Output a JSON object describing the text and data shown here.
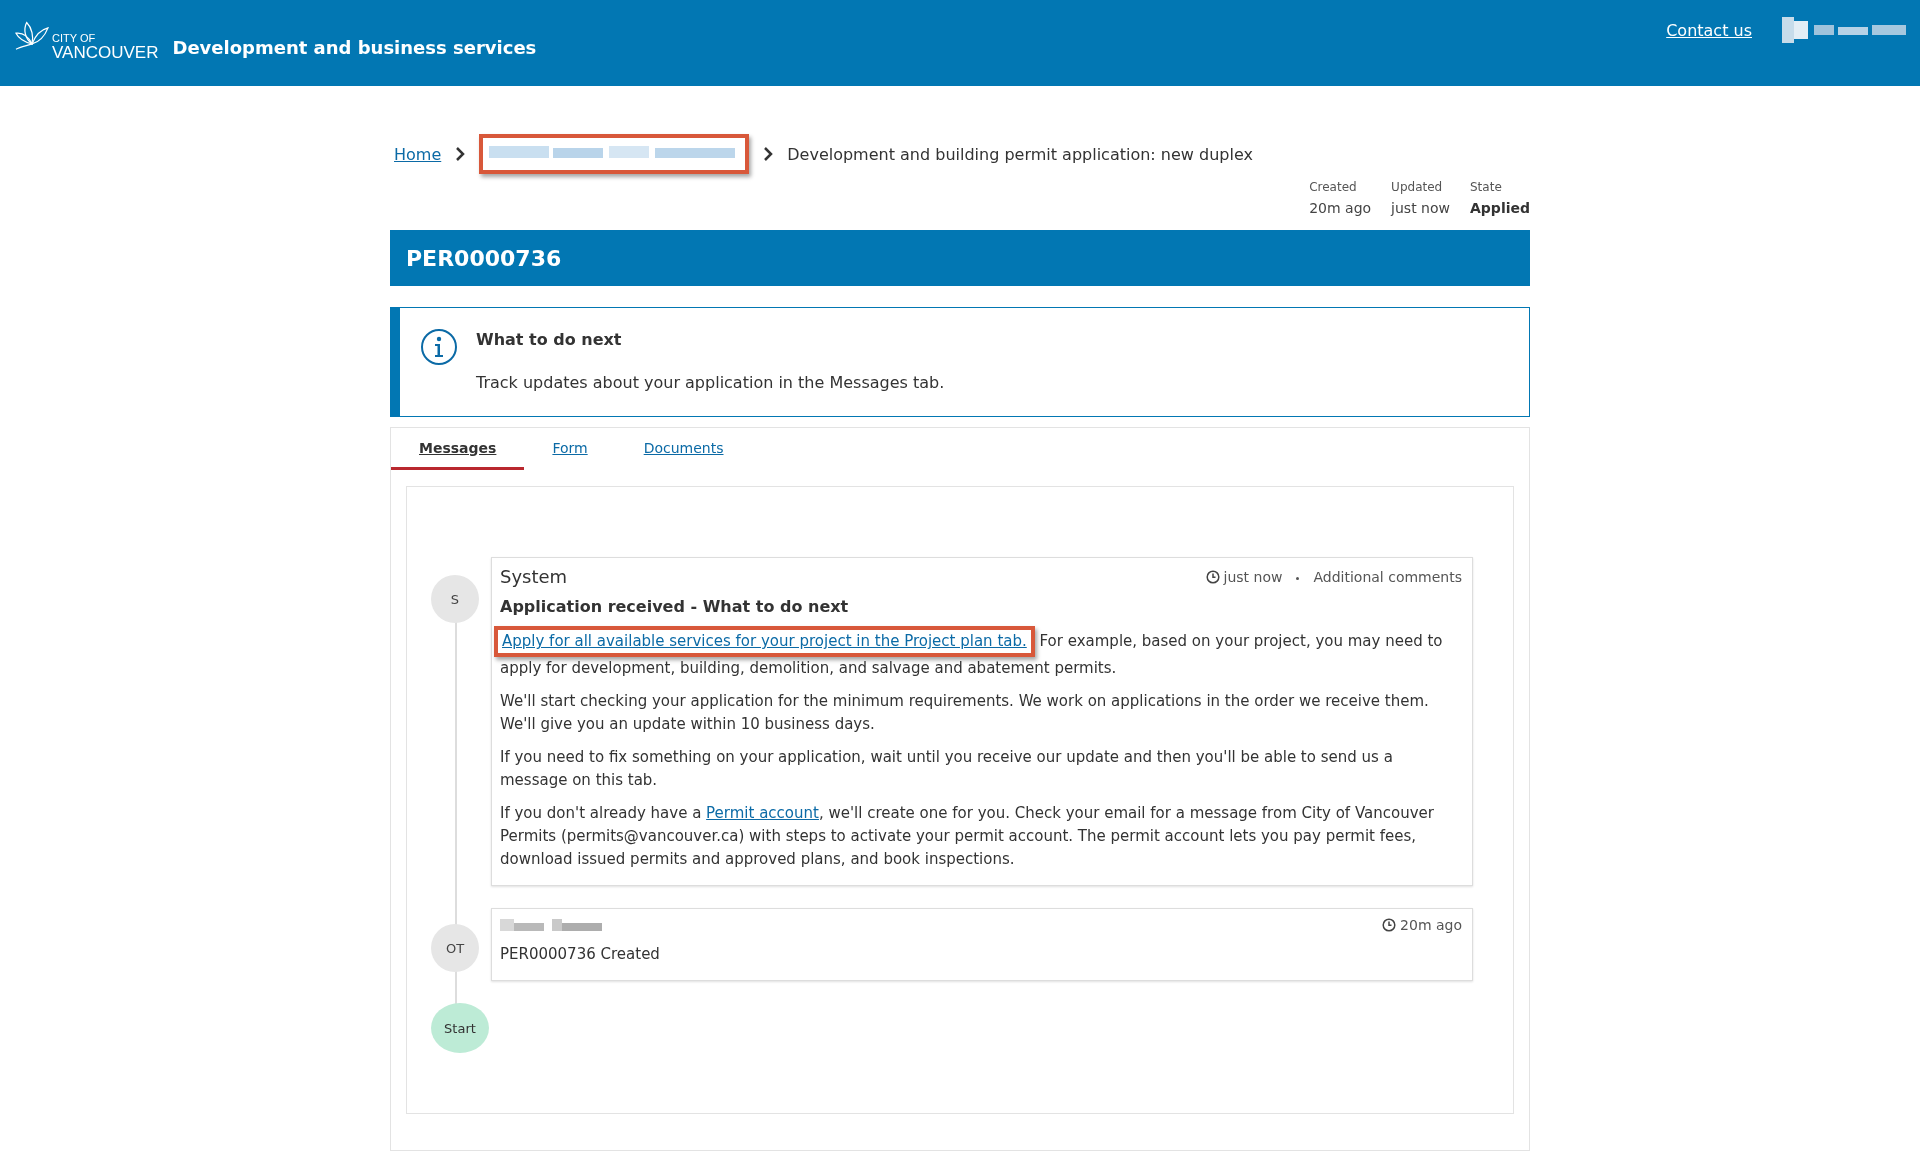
{
  "header": {
    "logo": {
      "line1": "CITY OF",
      "line2": "VANCOUVER"
    },
    "title": "Development and business services",
    "contact": "Contact us"
  },
  "breadcrumb": [
    {
      "kind": "link",
      "label": "Home"
    },
    {
      "kind": "redacted",
      "highlighted": true
    },
    {
      "kind": "current",
      "label": "Development and building permit application: new duplex"
    }
  ],
  "meta": [
    {
      "label": "Created",
      "value": "20m ago",
      "emphasis": false
    },
    {
      "label": "Updated",
      "value": "just now",
      "emphasis": false
    },
    {
      "label": "State",
      "value": "Applied",
      "emphasis": true
    }
  ],
  "permit_id": "PER0000736",
  "notice": {
    "title": "What to do next",
    "text": "Track updates about your application in the Messages tab."
  },
  "tabs": [
    {
      "label": "Messages",
      "selected": true
    },
    {
      "label": "Form",
      "selected": false
    },
    {
      "label": "Documents",
      "selected": false
    }
  ],
  "messages": [
    {
      "avatar": "S",
      "author": "System",
      "time": "just now",
      "category": "Additional comments",
      "subject": "Application received - What to do next",
      "paragraphs": [
        [
          {
            "kind": "highlighted_link",
            "text": "Apply for all available services for your project in the Project plan tab."
          },
          {
            "kind": "text",
            "text": " For example, based on your project, you may need to apply for development, building, demolition, and salvage and abatement permits."
          }
        ],
        [
          {
            "kind": "text",
            "text": "We'll start checking your application for the minimum requirements. We work on applications in the order we receive them. We'll give you an update within 10 business days."
          }
        ],
        [
          {
            "kind": "text",
            "text": "If you need to fix something on your application, wait until you receive our update and then you'll be able to send us a message on this tab."
          }
        ],
        [
          {
            "kind": "text",
            "text": "If you don't already have a "
          },
          {
            "kind": "link",
            "text": "Permit account"
          },
          {
            "kind": "text",
            "text": ", we'll create one for you. Check your email for a message from City of Vancouver Permits (permits@vancouver.ca) with steps to activate your permit account. The permit account lets you pay permit fees, download issued permits and approved plans, and book inspections."
          }
        ]
      ]
    },
    {
      "avatar": "OT",
      "time": "20m ago",
      "paragraphs": [
        [
          {
            "kind": "text",
            "text": "PER0000736 Created"
          }
        ]
      ]
    }
  ],
  "start_label": "Start"
}
